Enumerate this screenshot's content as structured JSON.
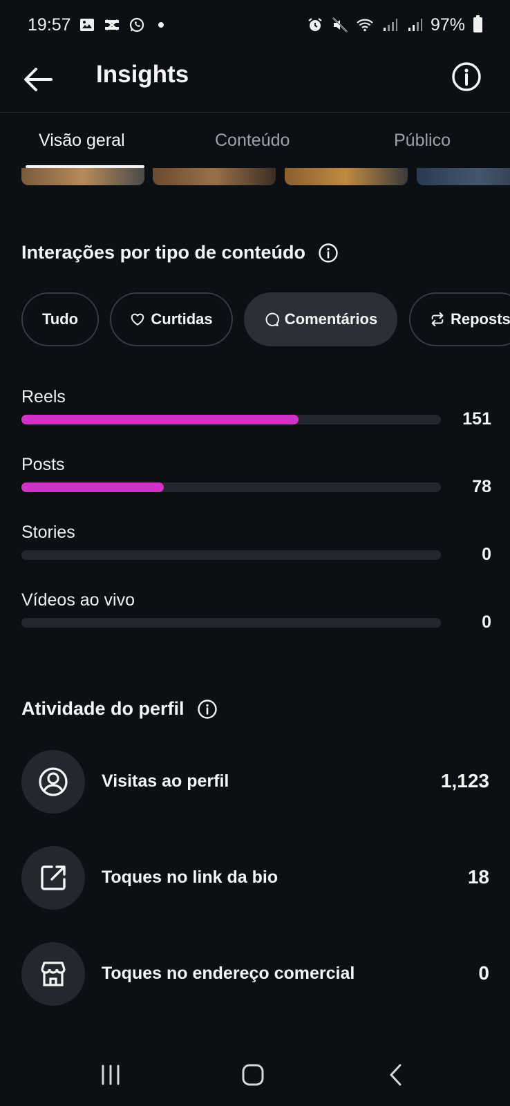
{
  "status_bar": {
    "time": "19:57",
    "battery": "97%",
    "left_icons": [
      "gallery-icon",
      "capcut-icon",
      "whatsapp-icon",
      "notification-dot"
    ],
    "right_icons": [
      "alarm-icon",
      "mute-icon",
      "wifi-icon",
      "signal-icon",
      "signal-icon",
      "battery-icon"
    ]
  },
  "header": {
    "title": "Insights",
    "back_icon": "arrow-left-icon",
    "info_icon": "info-icon"
  },
  "tabs": [
    {
      "label": "Visão geral",
      "active": true
    },
    {
      "label": "Conteúdo",
      "active": false
    },
    {
      "label": "Público",
      "active": false
    }
  ],
  "interactions": {
    "title": "Interações por tipo de conteúdo",
    "filters": [
      {
        "label": "Tudo",
        "icon": "",
        "active": false
      },
      {
        "label": "Curtidas",
        "icon": "heart-icon",
        "active": false
      },
      {
        "label": "Comentários",
        "icon": "comment-icon",
        "active": true
      },
      {
        "label": "Reposts",
        "icon": "repost-icon",
        "active": false
      }
    ],
    "bars": [
      {
        "label": "Reels",
        "value": "151",
        "fraction": 0.66
      },
      {
        "label": "Posts",
        "value": "78",
        "fraction": 0.34
      },
      {
        "label": "Stories",
        "value": "0",
        "fraction": 0
      },
      {
        "label": "Vídeos ao vivo",
        "value": "0",
        "fraction": 0
      }
    ]
  },
  "profile_activity": {
    "title": "Atividade do perfil",
    "rows": [
      {
        "label": "Visitas ao perfil",
        "value": "1,123",
        "icon": "profile-icon"
      },
      {
        "label": "Toques no link da bio",
        "value": "18",
        "icon": "external-link-icon"
      },
      {
        "label": "Toques no endereço comercial",
        "value": "0",
        "icon": "storefront-icon"
      }
    ]
  },
  "colors": {
    "background": "#0c1014",
    "bar_fill": "#d531c9",
    "bar_track": "#24272d"
  },
  "navbar": {
    "icons": [
      "recents-icon",
      "home-icon",
      "back-icon"
    ]
  }
}
